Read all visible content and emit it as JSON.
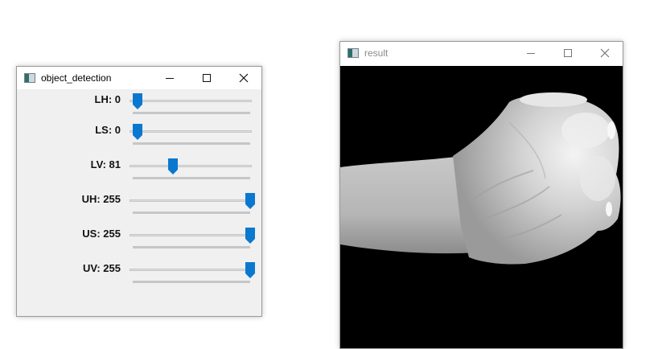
{
  "control_window": {
    "title": "object_detection",
    "icon": "window-app-icon",
    "trackbars": [
      {
        "label": "LH: 0",
        "name": "LH",
        "value": 0,
        "max": 255
      },
      {
        "label": "LS: 0",
        "name": "LS",
        "value": 0,
        "max": 255
      },
      {
        "label": "LV: 81",
        "name": "LV",
        "value": 81,
        "max": 255
      },
      {
        "label": "UH: 255",
        "name": "UH",
        "value": 255,
        "max": 255
      },
      {
        "label": "US: 255",
        "name": "US",
        "value": 255,
        "max": 255
      },
      {
        "label": "UV: 255",
        "name": "UV",
        "value": 255,
        "max": 255
      }
    ],
    "accent_color": "#0b78d0"
  },
  "result_window": {
    "title": "result",
    "icon": "window-app-icon",
    "content": "masked grayscale image of a clenched fist on black background"
  }
}
